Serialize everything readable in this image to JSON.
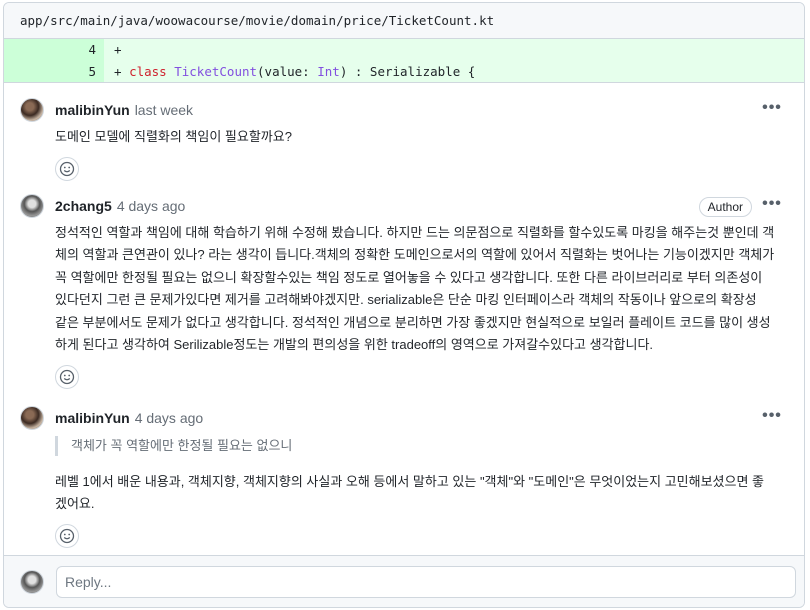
{
  "file": {
    "path": "app/src/main/java/woowacourse/movie/domain/price/TicketCount.kt"
  },
  "diff": {
    "lines": [
      {
        "num": "4",
        "marker": "+",
        "tokens": []
      },
      {
        "num": "5",
        "marker": "+",
        "kw": "class",
        "name": "TicketCount",
        "open": "(value: ",
        "type": "Int",
        "rest": ") : Serializable {"
      }
    ]
  },
  "comments": [
    {
      "author": "malibinYun",
      "time": "last week",
      "body": "도메인 모델에 직렬화의 책임이 필요할까요?"
    },
    {
      "author": "2chang5",
      "time": "4 days ago",
      "badge": "Author",
      "body": [
        "정석적인 역할과 책임에 대해 학습하기 위해 수정해 봤습니다. 하지만 드는 의문점으로 직렬화를 할수있도록 마킹을 해주는것 뿐인데 객",
        "체의 역할과 큰연관이 있나? 라는 생각이 듭니다.객체의 정확한 도메인으로서의 역할에 있어서 직렬화는 벗어나는 기능이겠지만 객체가",
        "꼭 역할에만 한정될 필요는 없으니 확장할수있는 책임 정도로 열어놓을 수 있다고 생각합니다. 또한 다른 라이브러리로 부터 의존성이",
        "있다던지 그런 큰 문제가있다면 제거를 고려해봐야겠지만. serializable은 단순 마킹 인터페이스라 객체의 작동이나 앞으로의 확장성",
        "같은 부분에서도 문제가 없다고 생각합니다. 정석적인 개념으로 분리하면 가장 좋겠지만 현실적으로 보일러 플레이트 코드를 많이 생성",
        "하게 된다고 생각하여 Serilizable정도는 개발의 편의성을 위한 tradeoff의 영역으로 가져갈수있다고 생각합니다."
      ]
    },
    {
      "author": "malibinYun",
      "time": "4 days ago",
      "quote": "객체가 꼭 역할에만 한정될 필요는 없으니",
      "body": [
        "레벨 1에서 배운 내용과, 객체지향, 객체지향의 사실과 오해 등에서 말하고 있는 \"객체\"와 \"도메인\"은 무엇이었는지 고민해보셨으면 좋",
        "겠어요."
      ]
    }
  ],
  "more_label": "•••",
  "reply": {
    "placeholder": "Reply..."
  }
}
